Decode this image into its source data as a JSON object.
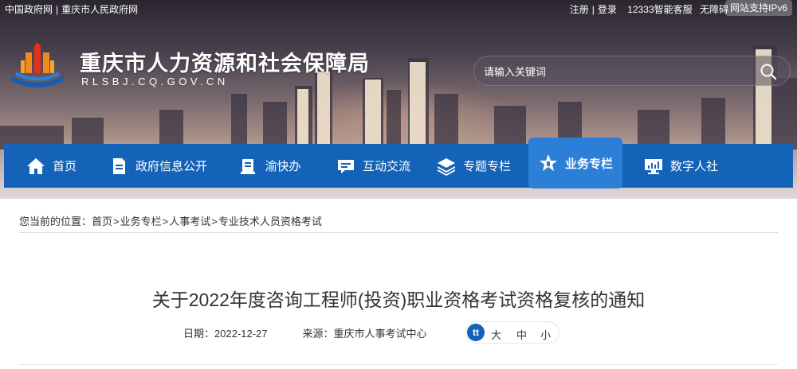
{
  "top_links": {
    "gov_portal": "中国政府网",
    "separator": "|",
    "city_gov": "重庆市人民政府网",
    "register": "注册",
    "login": "登录",
    "service_hotline": "12333智能客服",
    "accessibility": "无障碍",
    "ipv6": "网站支持IPv6"
  },
  "site": {
    "title": "重庆市人力资源和社会保障局",
    "domain": "RLSBJ.CQ.GOV.CN"
  },
  "search": {
    "placeholder": "请输入关键词",
    "icon": "search-icon"
  },
  "nav": {
    "items": [
      {
        "label": "首页",
        "icon": "home-icon"
      },
      {
        "label": "政府信息公开",
        "icon": "document-icon"
      },
      {
        "label": "渝快办",
        "icon": "book-icon"
      },
      {
        "label": "互动交流",
        "icon": "chat-icon"
      },
      {
        "label": "专题专栏",
        "icon": "layers-icon"
      },
      {
        "label": "业务专栏",
        "icon": "star-icon",
        "active": true
      },
      {
        "label": "数字人社",
        "icon": "monitor-icon"
      }
    ]
  },
  "breadcrumb": {
    "prefix": "您当前的位置：",
    "items": [
      "首页",
      "业务专栏",
      "人事考试",
      "专业技术人员资格考试"
    ],
    "separator": ">"
  },
  "article": {
    "title": "关于2022年度咨询工程师(投资)职业资格考试资格复核的通知",
    "date_label": "日期：",
    "date": "2022-12-27",
    "source_label": "来源：",
    "source": "重庆市人事考试中心",
    "font_size": {
      "icon": "tt",
      "large": "大",
      "medium": "中",
      "small": "小"
    }
  },
  "colors": {
    "nav_blue": "#1463b8",
    "nav_active": "#2b7fd6",
    "logo_orange": "#f08a1c",
    "logo_blue": "#1a5cb0"
  }
}
